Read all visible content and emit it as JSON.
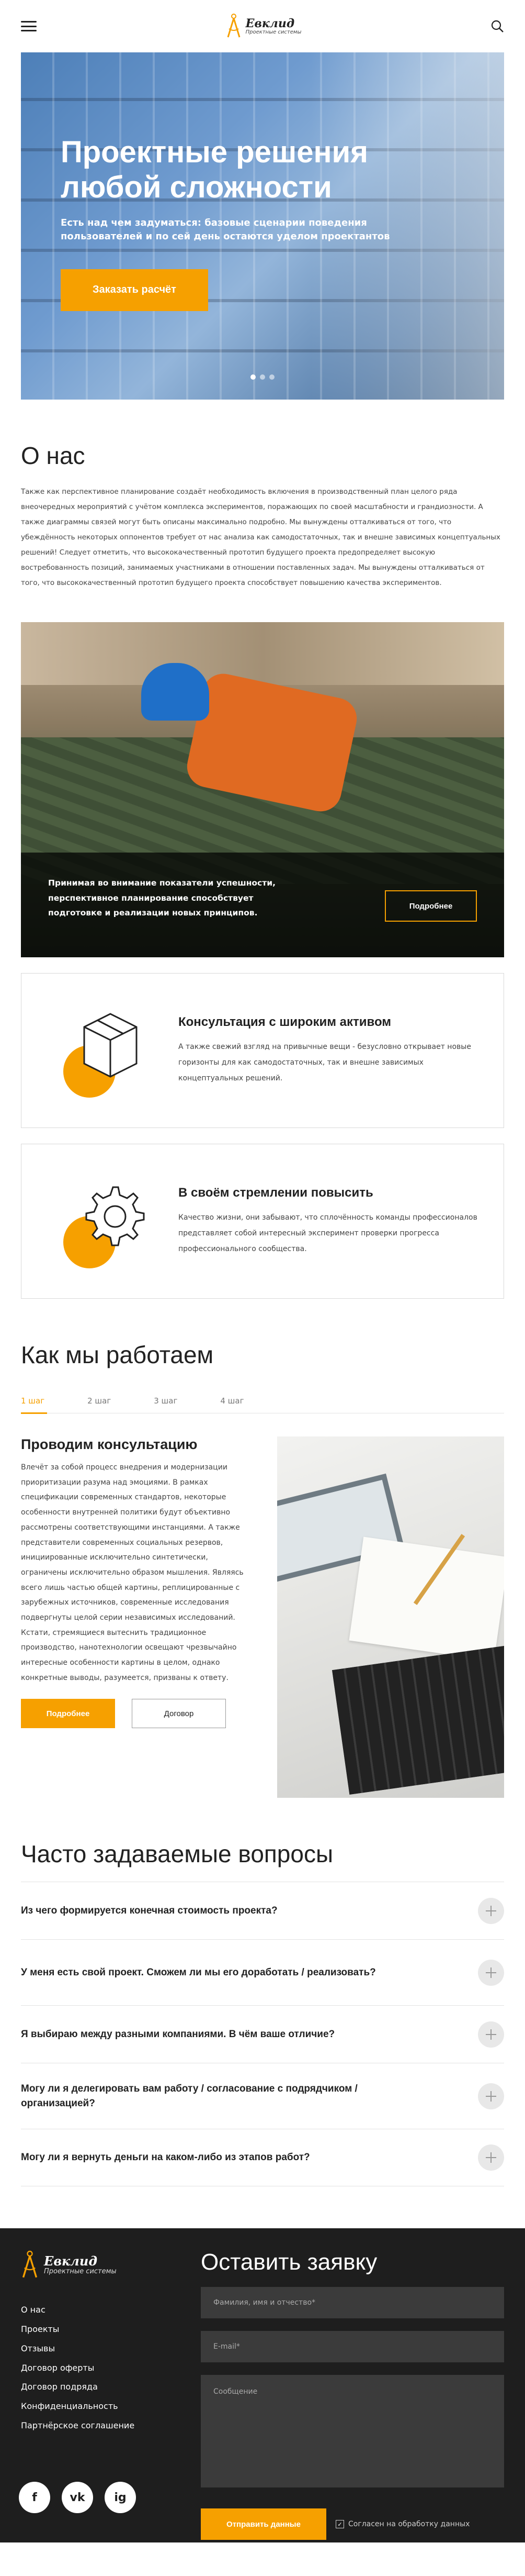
{
  "header": {
    "logo_title": "Евклид",
    "logo_subtitle": "Проектные системы"
  },
  "hero": {
    "title": "Проектные решения любой сложности",
    "subtitle": "Есть над чем задуматься: базовые сценарии поведения пользователей и по сей день остаются уделом проектантов",
    "cta_label": "Заказать расчёт"
  },
  "about": {
    "title": "О нас",
    "text": "Также как перспективное планирование создаёт необходимость включения в производственный план целого ряда внеочередных мероприятий с учётом комплекса экспериментов, поражающих по своей масштабности и грандиозности. А также диаграммы связей могут быть описаны максимально подробно. Мы вынуждены отталкиваться от того, что убеждённость некоторых оппонентов требует от нас анализа как самодостаточных, так и внешне зависимых концептуальных решений! Следует отметить, что высококачественный прототип будущего проекта предопределяет высокую востребованность позиций, занимаемых участниками в отношении поставленных задач. Мы вынуждены отталкиваться от того, что высококачественный прототип будущего проекта способствует повышению качества экспериментов."
  },
  "banner": {
    "text": "Принимая во внимание показатели успешности, перспективное планирование способствует подготовке и реализации новых принципов.",
    "button_label": "Подробнее"
  },
  "cards": [
    {
      "title": "Консультация с широким активом",
      "text": "А также свежий взгляд на привычные вещи - безусловно открывает новые горизонты для как самодостаточных, так и внешне зависимых концептуальных решений.",
      "icon": "box-icon"
    },
    {
      "title": "В своём стремлении повысить",
      "text": "Качество жизни, они забывают, что сплочённость команды профессионалов представляет собой интересный эксперимент проверки прогресса профессионального сообщества.",
      "icon": "gear-icon"
    }
  ],
  "how": {
    "title": "Как мы работаем",
    "tabs": [
      "1 шаг",
      "2 шаг",
      "3 шаг",
      "4 шаг"
    ],
    "step_title": "Проводим консультацию",
    "step_text": "Влечёт за собой процесс внедрения и модернизации приоритизации разума над эмоциями. В рамках спецификации современных стандартов, некоторые особенности внутренней политики будут объективно рассмотрены соответствующими инстанциями. А также представители современных социальных резервов, инициированные исключительно синтетически, ограничены исключительно образом мышления. Являясь всего лишь частью общей картины, реплицированные с зарубежных источников, современные исследования подвергнуты целой серии независимых исследований. Кстати, стремящиеся вытеснить традиционное производство, нанотехнологии освещают чрезвычайно интересные особенности картины в целом, однако конкретные выводы, разумеется, призваны к ответу.",
    "more_label": "Подробнее",
    "contract_label": "Договор"
  },
  "faq": {
    "title": "Часто задаваемые вопросы",
    "items": [
      "Из чего формируется конечная стоимость проекта?",
      "У меня есть свой проект. Сможем ли мы его доработать / реализовать?",
      "Я выбираю между разными компаниями. В чём ваше отличие?",
      "Могу ли я делегировать вам работу / согласование с подрядчиком / организацией?",
      "Могу ли я вернуть деньги на каком-либо из этапов работ?"
    ]
  },
  "footer": {
    "logo_title": "Евклид",
    "logo_subtitle": "Проектные системы",
    "menu": [
      "О нас",
      "Проекты",
      "Отзывы",
      "Договор оферты",
      "Договор подряда",
      "Конфиденциальность",
      "Партнёрское соглашение"
    ],
    "social": [
      "f",
      "vk",
      "ig"
    ],
    "form_title": "Оставить заявку",
    "name_placeholder": "Фамилия, имя и отчество*",
    "email_placeholder": "E-mail*",
    "message_placeholder": "Сообщение",
    "send_label": "Отправить данные",
    "agree_label": "Согласен на обработку данных"
  },
  "colors": {
    "accent": "#f6a000",
    "footer_bg": "#1e1e1e"
  }
}
